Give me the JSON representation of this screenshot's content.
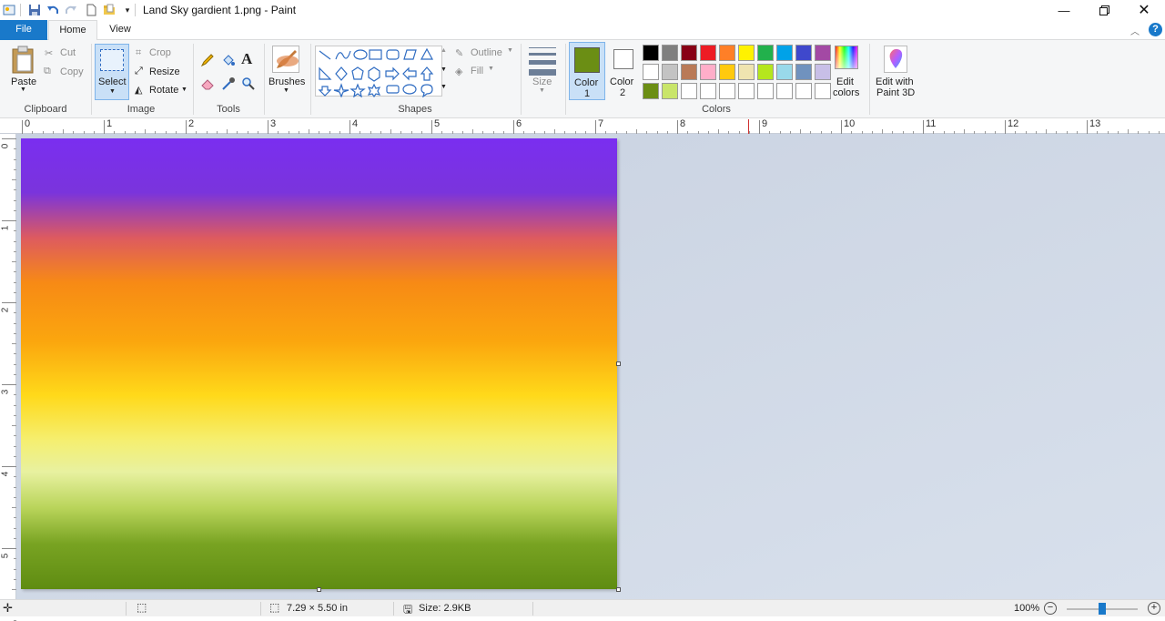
{
  "window": {
    "title": "Land Sky gardient 1.png - Paint"
  },
  "titlebar_icons": [
    "paint-app-icon",
    "save-icon",
    "undo-icon",
    "redo-icon",
    "new-icon",
    "folder-icon",
    "qa-dropdown-icon"
  ],
  "tabs": {
    "file": "File",
    "home": "Home",
    "view": "View"
  },
  "ribbon": {
    "clipboard": {
      "group": "Clipboard",
      "paste": "Paste",
      "cut": "Cut",
      "copy": "Copy"
    },
    "image": {
      "group": "Image",
      "select": "Select",
      "crop": "Crop",
      "resize": "Resize",
      "rotate": "Rotate"
    },
    "tools": {
      "group": "Tools"
    },
    "brushes": {
      "label": "Brushes"
    },
    "shapes": {
      "group": "Shapes",
      "outline": "Outline",
      "fill": "Fill"
    },
    "size": {
      "label": "Size"
    },
    "colors": {
      "group": "Colors",
      "color1": "Color\n1",
      "color1_line1": "Color",
      "color1_line2": "1",
      "color2_line1": "Color",
      "color2_line2": "2",
      "color1_value": "#6b8e14",
      "color2_value": "#ffffff",
      "edit_line1": "Edit",
      "edit_line2": "colors",
      "palette": [
        "#000000",
        "#7f7f7f",
        "#880015",
        "#ed1c24",
        "#ff7f27",
        "#fff200",
        "#22b14c",
        "#00a2e8",
        "#3f48cc",
        "#a349a4",
        "#ffffff",
        "#c3c3c3",
        "#b97a57",
        "#ffaec9",
        "#ffc90e",
        "#efe4b0",
        "#b5e61d",
        "#99d9ea",
        "#7092be",
        "#c8bfe7",
        "#6b8e14",
        "#c9e56a",
        "#ffffff",
        "#ffffff",
        "#ffffff",
        "#ffffff",
        "#ffffff",
        "#ffffff",
        "#ffffff",
        "#ffffff"
      ]
    },
    "paint3d": {
      "line1": "Edit with",
      "line2": "Paint 3D"
    }
  },
  "ruler": {
    "h": [
      "0",
      "1",
      "2",
      "3",
      "4",
      "5",
      "6",
      "7",
      "8",
      "9",
      "10",
      "11",
      "12",
      "13"
    ],
    "v": [
      "0",
      "1",
      "2",
      "3",
      "4",
      "5"
    ]
  },
  "status": {
    "dimensions": "7.29 × 5.50 in",
    "size": "Size: 2.9KB",
    "zoom": "100%",
    "zoom_level": 1.0
  }
}
